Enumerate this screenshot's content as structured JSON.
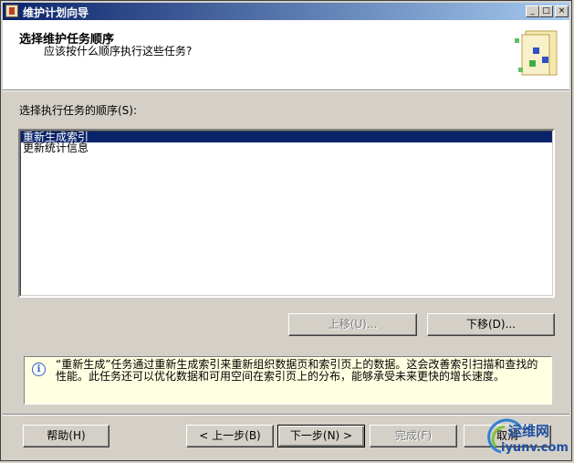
{
  "window": {
    "title": "维护计划向导"
  },
  "titlebar_buttons": {
    "minimize": "_",
    "maximize": "□",
    "close": "×"
  },
  "header": {
    "title": "选择维护任务顺序",
    "subtitle": "应该按什么顺序执行这些任务?"
  },
  "order_label": "选择执行任务的顺序(S):",
  "tasks": [
    {
      "label": "重新生成索引",
      "selected": true
    },
    {
      "label": "更新统计信息",
      "selected": false
    }
  ],
  "buttons": {
    "move_up": "上移(U)...",
    "move_down": "下移(D)...",
    "help": "帮助(H)",
    "back": "< 上一步(B)",
    "next": "下一步(N) >",
    "finish": "完成(F)",
    "cancel": "取消"
  },
  "info": {
    "text": "“重新生成”任务通过重新生成索引来重新组织数据页和索引页上的数据。这会改善索引扫描和查找的性能。此任务还可以优化数据和可用空间在索引页上的分布，能够承受未来更快的增长速度。"
  },
  "watermark": {
    "line1": "运维网",
    "line2": "iyunv.com"
  },
  "colors": {
    "titlebar": "#0a246a",
    "selection": "#0a246a",
    "info_bg": "#ffffe1",
    "window": "#d4d0c8"
  }
}
